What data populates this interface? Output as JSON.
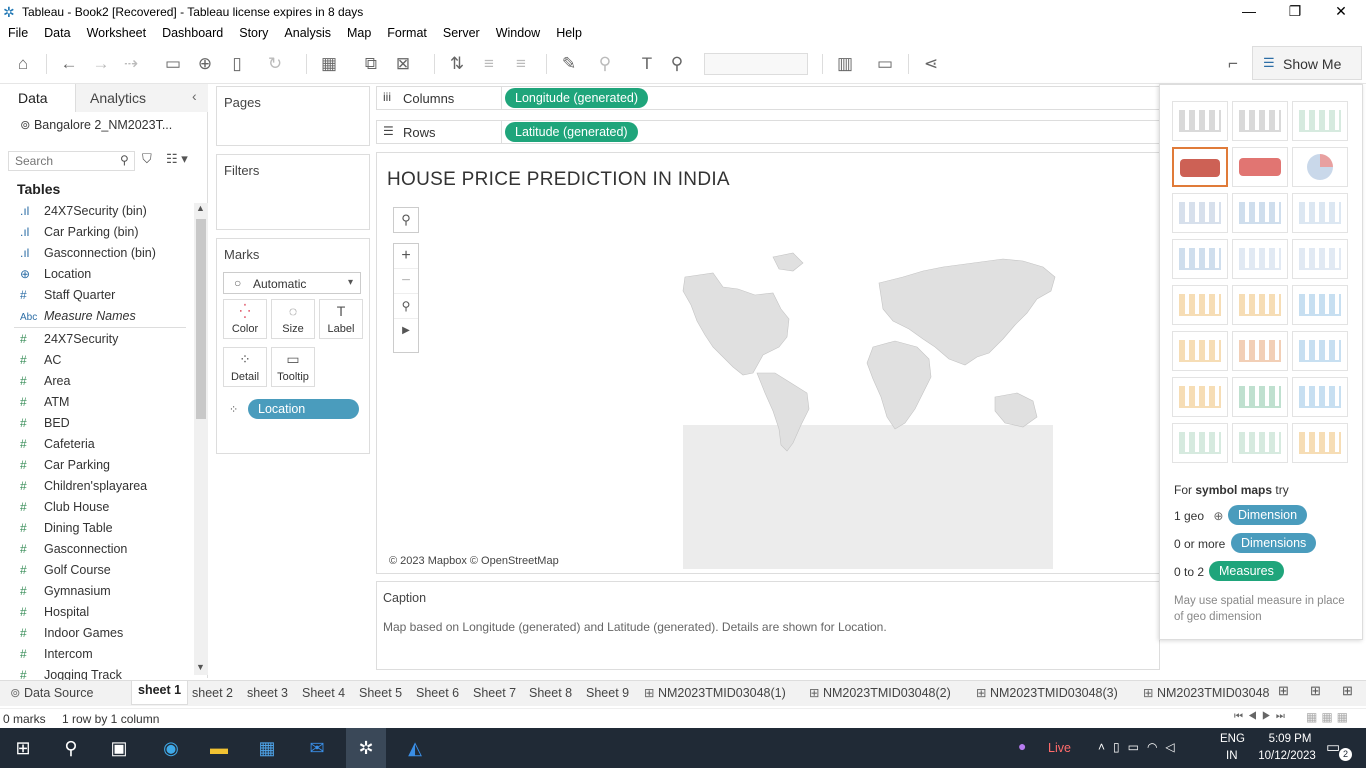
{
  "window": {
    "title": "Tableau - Book2 [Recovered] - Tableau license expires in 8 days"
  },
  "menu": [
    "File",
    "Data",
    "Worksheet",
    "Dashboard",
    "Story",
    "Analysis",
    "Map",
    "Format",
    "Server",
    "Window",
    "Help"
  ],
  "showme_label": "Show Me",
  "leftpane": {
    "tab_data": "Data",
    "tab_analytics": "Analytics",
    "datasource": "Bangalore 2_NM2023T...",
    "search_placeholder": "Search",
    "tables_heading": "Tables",
    "dimension_fields": [
      {
        "icon": "bin",
        "name": "24X7Security (bin)"
      },
      {
        "icon": "bin",
        "name": "Car Parking (bin)"
      },
      {
        "icon": "bin",
        "name": "Gasconnection (bin)"
      },
      {
        "icon": "globe",
        "name": "Location"
      },
      {
        "icon": "hash",
        "name": "Staff Quarter"
      },
      {
        "icon": "abc",
        "name": "Measure Names"
      }
    ],
    "measure_fields": [
      "24X7Security",
      "AC",
      "Area",
      "ATM",
      "BED",
      "Cafeteria",
      "Car Parking",
      "Children'splayarea",
      "Club House",
      "Dining Table",
      "Gasconnection",
      "Golf Course",
      "Gymnasium",
      "Hospital",
      "Indoor Games",
      "Intercom",
      "Jogging Track"
    ]
  },
  "pages_label": "Pages",
  "filters_label": "Filters",
  "marks": {
    "label": "Marks",
    "type": "Automatic",
    "buttons": [
      "Color",
      "Size",
      "Label",
      "Detail",
      "Tooltip"
    ],
    "detail_pill": "Location"
  },
  "columns": {
    "label": "Columns",
    "pill": "Longitude (generated)"
  },
  "rows": {
    "label": "Rows",
    "pill": "Latitude (generated)"
  },
  "sheet": {
    "title": "HOUSE PRICE PREDICTION IN INDIA",
    "attribution": "© 2023 Mapbox © OpenStreetMap"
  },
  "caption": {
    "label": "Caption",
    "text": "Map based on Longitude (generated) and Latitude (generated).  Details are shown for Location."
  },
  "showme": {
    "for_prefix": "For ",
    "for_bold": "symbol maps",
    "for_suffix": " try",
    "req1_prefix": "1 geo",
    "req1_pill": "Dimension",
    "req2_prefix": "0 or more",
    "req2_pill": "Dimensions",
    "req3_prefix": "0 to 2",
    "req3_pill": "Measures",
    "note": "May use spatial measure in place of geo dimension"
  },
  "tabs": {
    "datasource": "Data Source",
    "sheets": [
      "sheet 1",
      "sheet 2",
      "sheet 3",
      "Sheet 4",
      "Sheet 5",
      "Sheet 6",
      "Sheet 7",
      "Sheet 8",
      "Sheet 9"
    ],
    "dashboards": [
      "NM2023TMID03048(1)",
      "NM2023TMID03048(2)",
      "NM2023TMID03048(3)",
      "NM2023TMID03048"
    ]
  },
  "status": {
    "marks": "0 marks",
    "rows": "1 row by 1 column"
  },
  "taskbar": {
    "live": "Live",
    "lang1": "ENG",
    "lang2": "IN",
    "time": "5:09 PM",
    "date": "10/12/2023",
    "notif": "2"
  },
  "colors": {
    "accent_green": "#1fa57b",
    "dimension_blue": "#4a9cbd",
    "selected_thumb": "#e07b39",
    "taskbar": "#202a36"
  }
}
